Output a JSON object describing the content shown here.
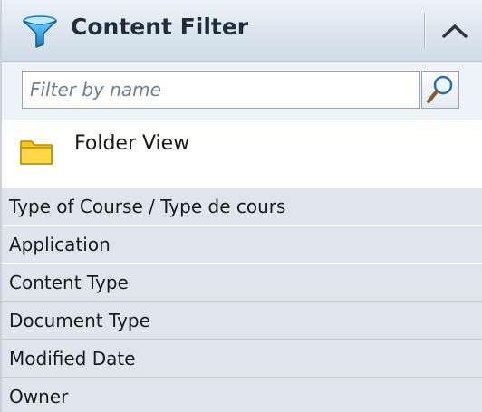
{
  "panel": {
    "title": "Content Filter",
    "title_icon": "funnel-icon",
    "collapse_icon": "chevron-up-icon"
  },
  "filter": {
    "placeholder": "Filter by name",
    "value": "",
    "search_icon": "magnifier-icon"
  },
  "folder_view": {
    "label": "Folder View",
    "icon": "folder-icon"
  },
  "categories": [
    {
      "label": "Type of Course / Type de cours"
    },
    {
      "label": "Application"
    },
    {
      "label": "Content Type"
    },
    {
      "label": "Document Type"
    },
    {
      "label": "Modified Date"
    },
    {
      "label": "Owner"
    }
  ],
  "colors": {
    "header_gradient_top": "#eef3f8",
    "header_gradient_bottom": "#cfdbe7",
    "category_bg": "#dee5ec",
    "funnel_blue": "#2a9fd8",
    "folder_yellow": "#f5c518"
  }
}
